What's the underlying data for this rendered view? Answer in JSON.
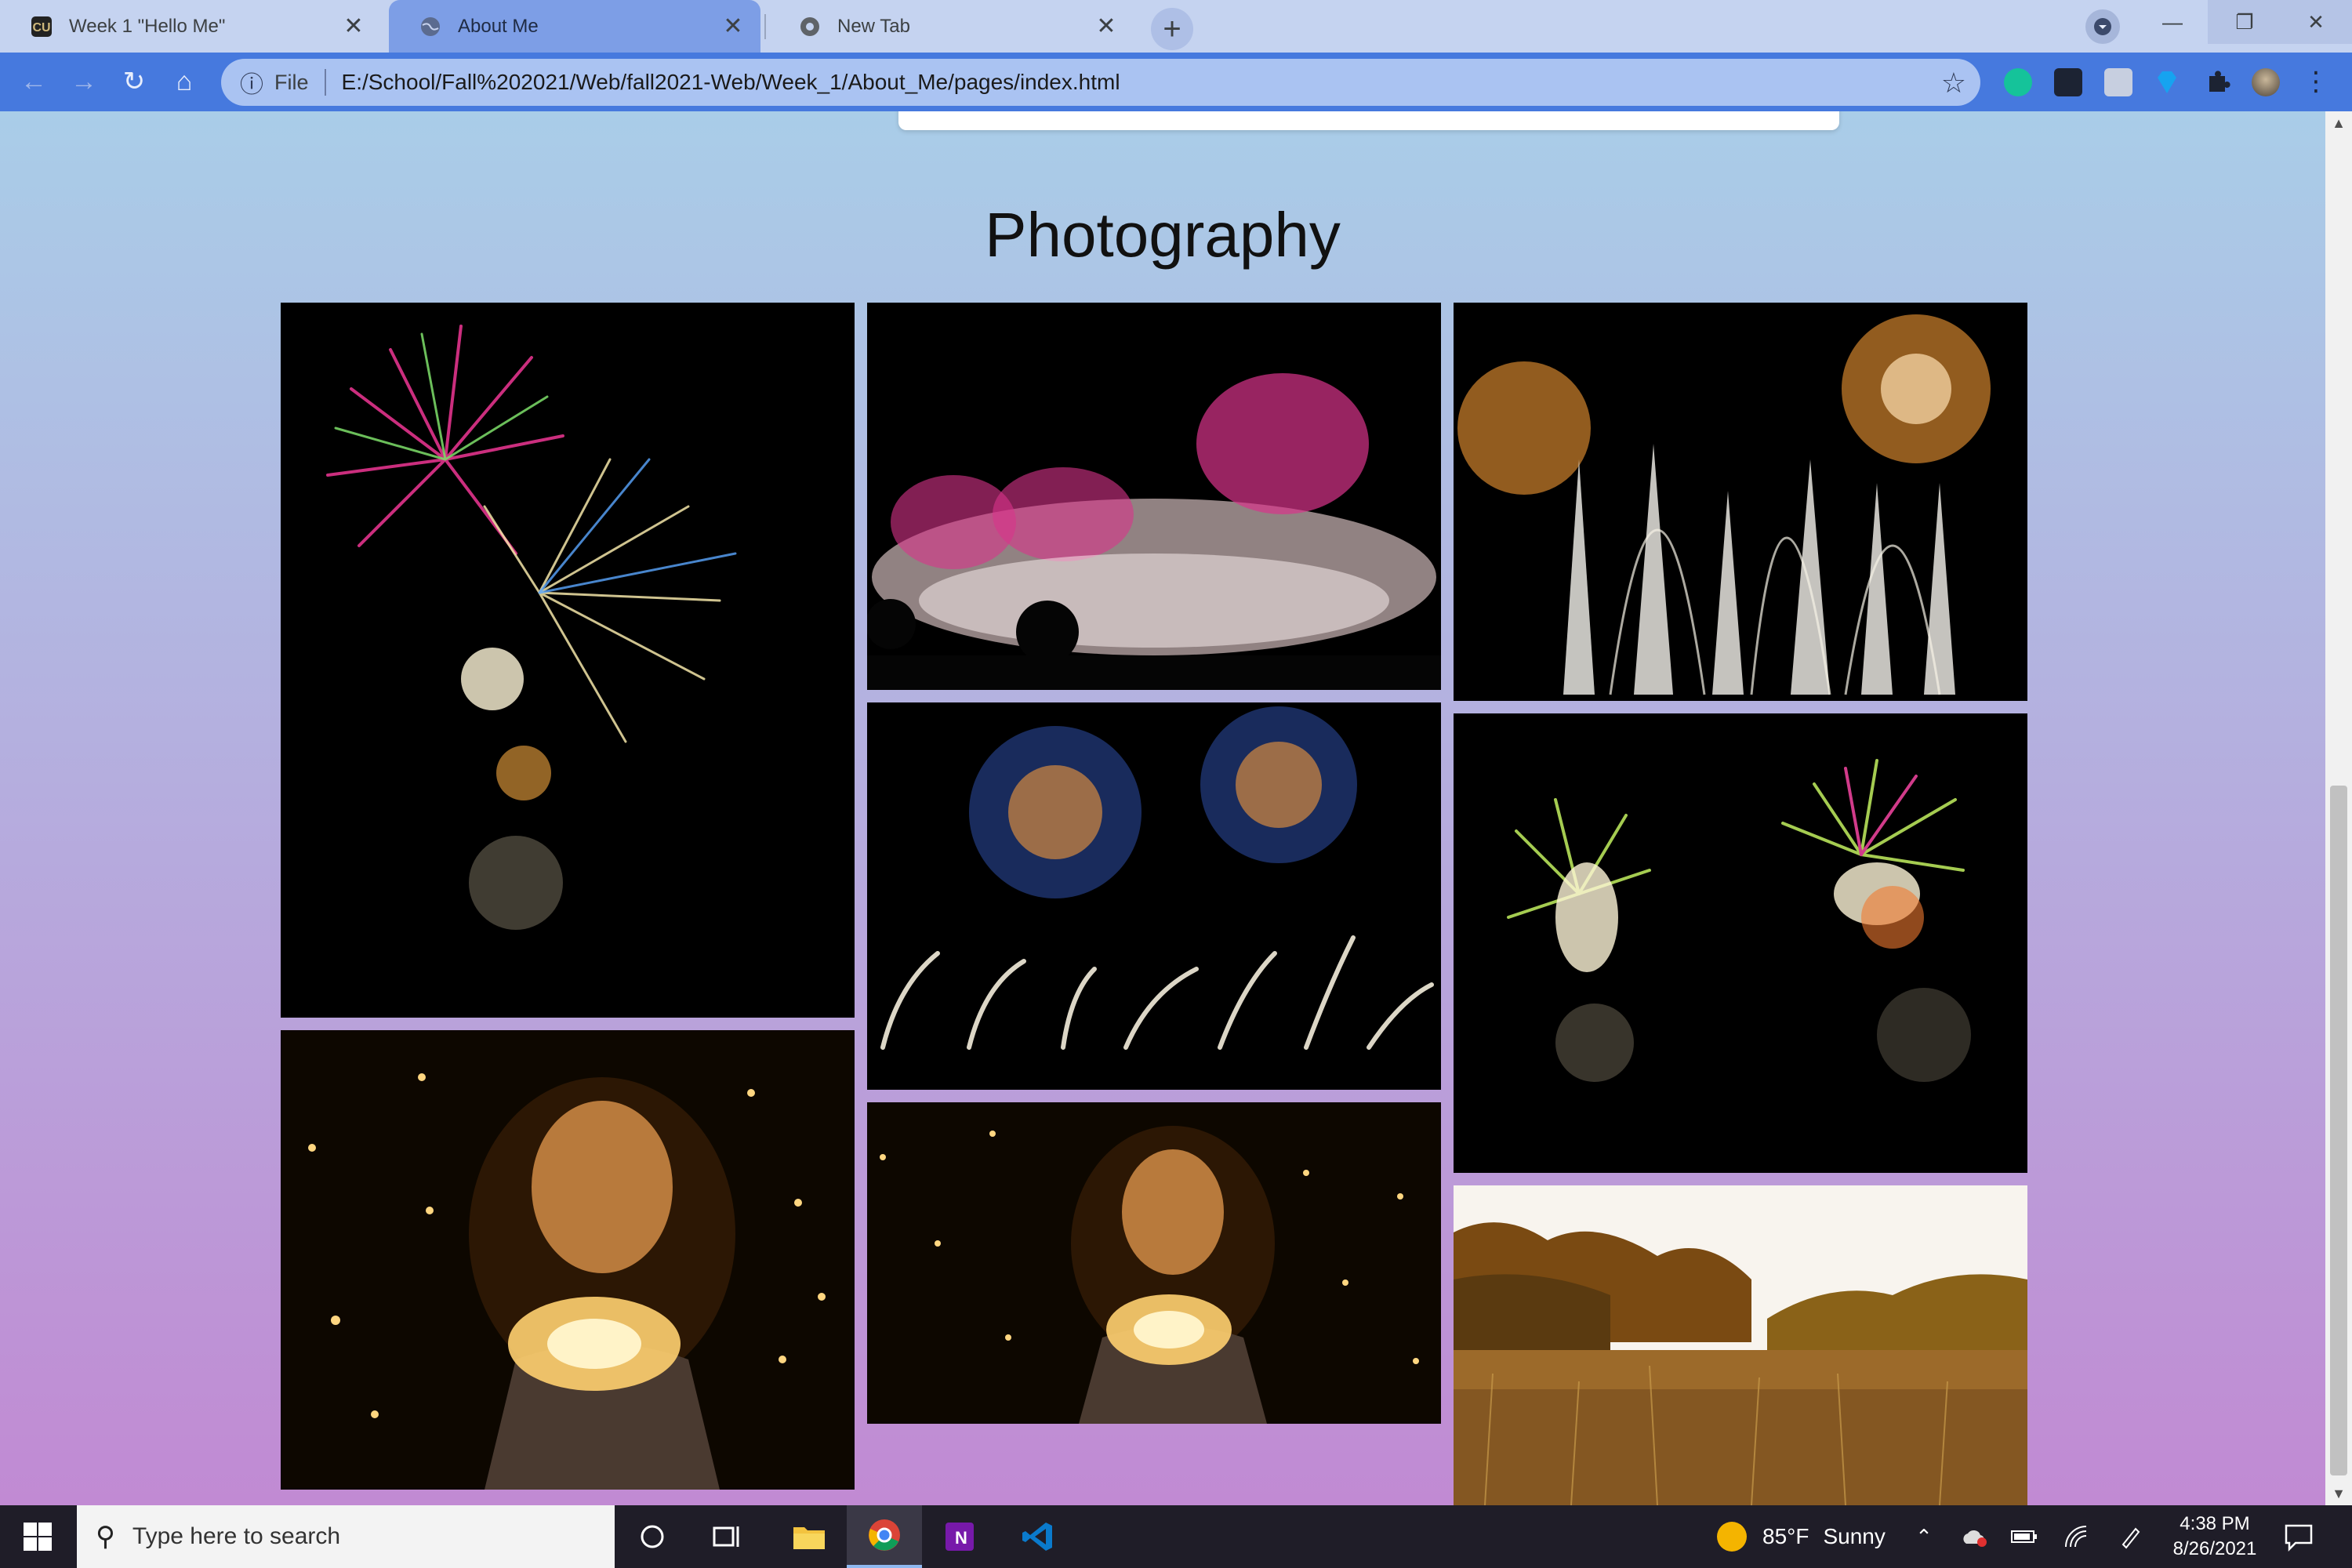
{
  "browser": {
    "tabs": [
      {
        "label": "Week 1 \"Hello Me\"",
        "active": false
      },
      {
        "label": "About Me",
        "active": true
      },
      {
        "label": "New Tab",
        "active": false
      }
    ],
    "close_glyph": "✕",
    "new_tab_glyph": "+",
    "window_controls": {
      "minimize": "—",
      "maximize": "❐",
      "close": "✕"
    },
    "toolbar": {
      "back_glyph": "←",
      "forward_glyph": "→",
      "reload_glyph": "↻",
      "home_glyph": "⌂",
      "info_glyph": "ⓘ",
      "scheme_label": "File",
      "url": "E:/School/Fall%202021/Web/fall2021-Web/Week_1/About_Me/pages/index.html",
      "star_glyph": "☆",
      "extensions": [
        "grammarly-icon",
        "dark-reader-icon",
        "extension-k-icon",
        "gem-icon",
        "puzzle-icon",
        "profile-avatar"
      ],
      "menu_glyph": "⋮"
    }
  },
  "page": {
    "heading": "Photography",
    "photos": [
      {
        "name": "photo-fireworks-tall",
        "subject": "fireworks"
      },
      {
        "name": "photo-fireworks-crowd",
        "subject": "fireworks"
      },
      {
        "name": "photo-fireworks-fountains",
        "subject": "fireworks"
      },
      {
        "name": "photo-fireworks-blue-bursts",
        "subject": "fireworks"
      },
      {
        "name": "photo-fireworks-green-bursts",
        "subject": "fireworks"
      },
      {
        "name": "photo-girl-lights-large",
        "subject": "portrait"
      },
      {
        "name": "photo-girl-lights-small",
        "subject": "portrait"
      },
      {
        "name": "photo-autumn-field",
        "subject": "landscape"
      }
    ]
  },
  "taskbar": {
    "search_placeholder": "Type here to search",
    "weather": {
      "temp": "85°F",
      "condition": "Sunny"
    },
    "clock": {
      "time": "4:38 PM",
      "date": "8/26/2021"
    },
    "tray_up_glyph": "⌃"
  },
  "colors": {
    "accent_toolbar": "#4679de",
    "gradient_top": "#a9cde8",
    "gradient_bottom": "#c18ad3"
  }
}
